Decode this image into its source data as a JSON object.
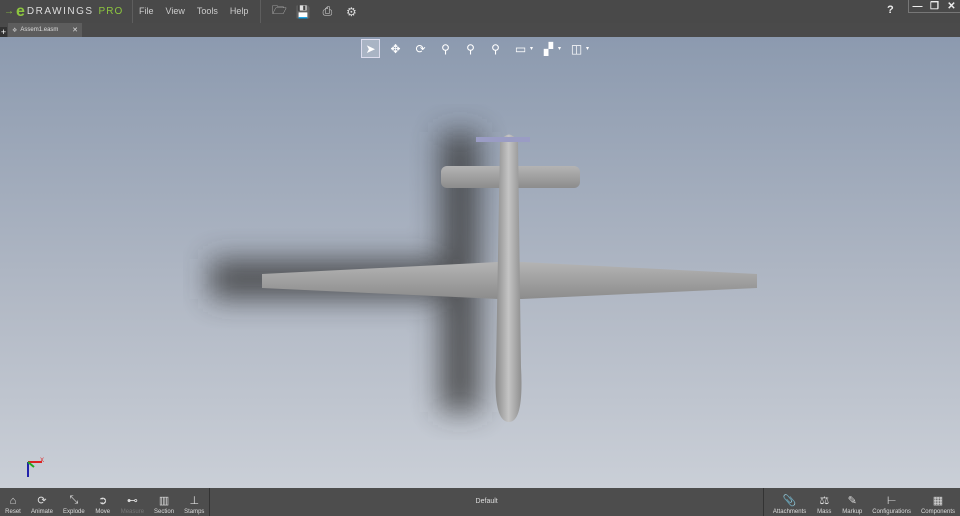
{
  "app": {
    "logo_e": "e",
    "logo_name": "DRAWINGS",
    "logo_edition": "PRO"
  },
  "menu": [
    "File",
    "View",
    "Tools",
    "Help"
  ],
  "window": {
    "help": "?",
    "minimize": "—",
    "restore": "❐",
    "close": "✕"
  },
  "tab": {
    "label": "Assem1.easm",
    "close": "✕",
    "new": "+"
  },
  "status": {
    "configuration": "Default"
  },
  "left_tools": [
    {
      "label": "Reset",
      "icon": "⌂"
    },
    {
      "label": "Animate",
      "icon": "⟳"
    },
    {
      "label": "Explode",
      "icon": "⤡"
    },
    {
      "label": "Move",
      "icon": "➲"
    },
    {
      "label": "Measure",
      "icon": "⊷",
      "disabled": true
    },
    {
      "label": "Section",
      "icon": "▥"
    },
    {
      "label": "Stamps",
      "icon": "⊥"
    }
  ],
  "right_tools": [
    {
      "label": "Attachments",
      "icon": "📎"
    },
    {
      "label": "Mass",
      "icon": "⚖"
    },
    {
      "label": "Markup",
      "icon": "✎"
    },
    {
      "label": "Configurations",
      "icon": "⊢"
    },
    {
      "label": "Components",
      "icon": "▦"
    }
  ],
  "triad": {
    "x_label": "X"
  }
}
